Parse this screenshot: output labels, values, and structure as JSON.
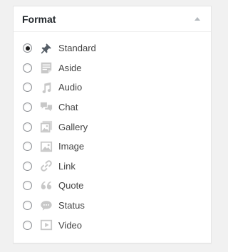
{
  "postbox": {
    "title": "Format"
  },
  "formats": [
    {
      "label": "Standard",
      "icon": "pushpin-icon",
      "checked": true
    },
    {
      "label": "Aside",
      "icon": "aside-icon",
      "checked": false
    },
    {
      "label": "Audio",
      "icon": "audio-icon",
      "checked": false
    },
    {
      "label": "Chat",
      "icon": "chat-icon",
      "checked": false
    },
    {
      "label": "Gallery",
      "icon": "gallery-icon",
      "checked": false
    },
    {
      "label": "Image",
      "icon": "image-icon",
      "checked": false
    },
    {
      "label": "Link",
      "icon": "link-icon",
      "checked": false
    },
    {
      "label": "Quote",
      "icon": "quote-icon",
      "checked": false
    },
    {
      "label": "Status",
      "icon": "status-icon",
      "checked": false
    },
    {
      "label": "Video",
      "icon": "video-icon",
      "checked": false
    }
  ],
  "colors": {
    "background": "#f1f1f1",
    "panel": "#ffffff",
    "title_text": "#23282d",
    "label_text": "#444444",
    "icon_gray": "#c8c8c8",
    "icon_standard": "#555d66"
  }
}
